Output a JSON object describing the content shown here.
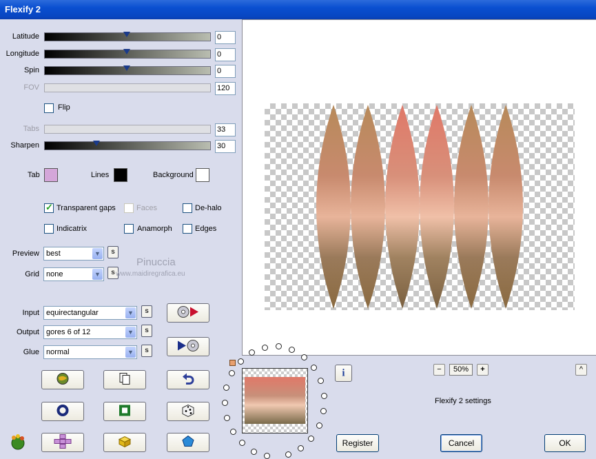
{
  "window": {
    "title": "Flexify 2"
  },
  "sliders": [
    {
      "label": "Latitude",
      "value": "0",
      "disabled": false
    },
    {
      "label": "Longitude",
      "value": "0",
      "disabled": false
    },
    {
      "label": "Spin",
      "value": "0",
      "disabled": false
    },
    {
      "label": "FOV",
      "value": "120",
      "disabled": true
    },
    {
      "label": "Tabs",
      "value": "33",
      "disabled": true
    },
    {
      "label": "Sharpen",
      "value": "30",
      "disabled": false
    }
  ],
  "flip": {
    "label": "Flip",
    "checked": false
  },
  "colors": {
    "tab": {
      "label": "Tab",
      "color": "#d4a6d9"
    },
    "lines": {
      "label": "Lines",
      "color": "#000000"
    },
    "background": {
      "label": "Background",
      "color": "#ffffff"
    }
  },
  "options": {
    "transparent_gaps": {
      "label": "Transparent gaps",
      "checked": true
    },
    "faces": {
      "label": "Faces",
      "checked": false,
      "disabled": true
    },
    "de_halo": {
      "label": "De-halo",
      "checked": false
    },
    "indicatrix": {
      "label": "Indicatrix",
      "checked": false
    },
    "anamorph": {
      "label": "Anamorph",
      "checked": false
    },
    "edges": {
      "label": "Edges",
      "checked": false
    }
  },
  "preview": {
    "label": "Preview",
    "value": "best"
  },
  "grid": {
    "label": "Grid",
    "value": "none"
  },
  "input": {
    "label": "Input",
    "value": "equirectangular"
  },
  "output": {
    "label": "Output",
    "value": "gores 6 of 12"
  },
  "glue": {
    "label": "Glue",
    "value": "normal"
  },
  "s_label": "s",
  "watermark": {
    "line1": "Pinuccia",
    "line2": "www.maidiregrafica.eu"
  },
  "zoom": {
    "value": "50%",
    "minus": "−",
    "plus": "+"
  },
  "settings_text": "Flexify 2 settings",
  "info_label": "i",
  "up_label": "^",
  "buttons": {
    "register": "Register",
    "cancel": "Cancel",
    "ok": "OK"
  },
  "accent": "#0a4fd0"
}
